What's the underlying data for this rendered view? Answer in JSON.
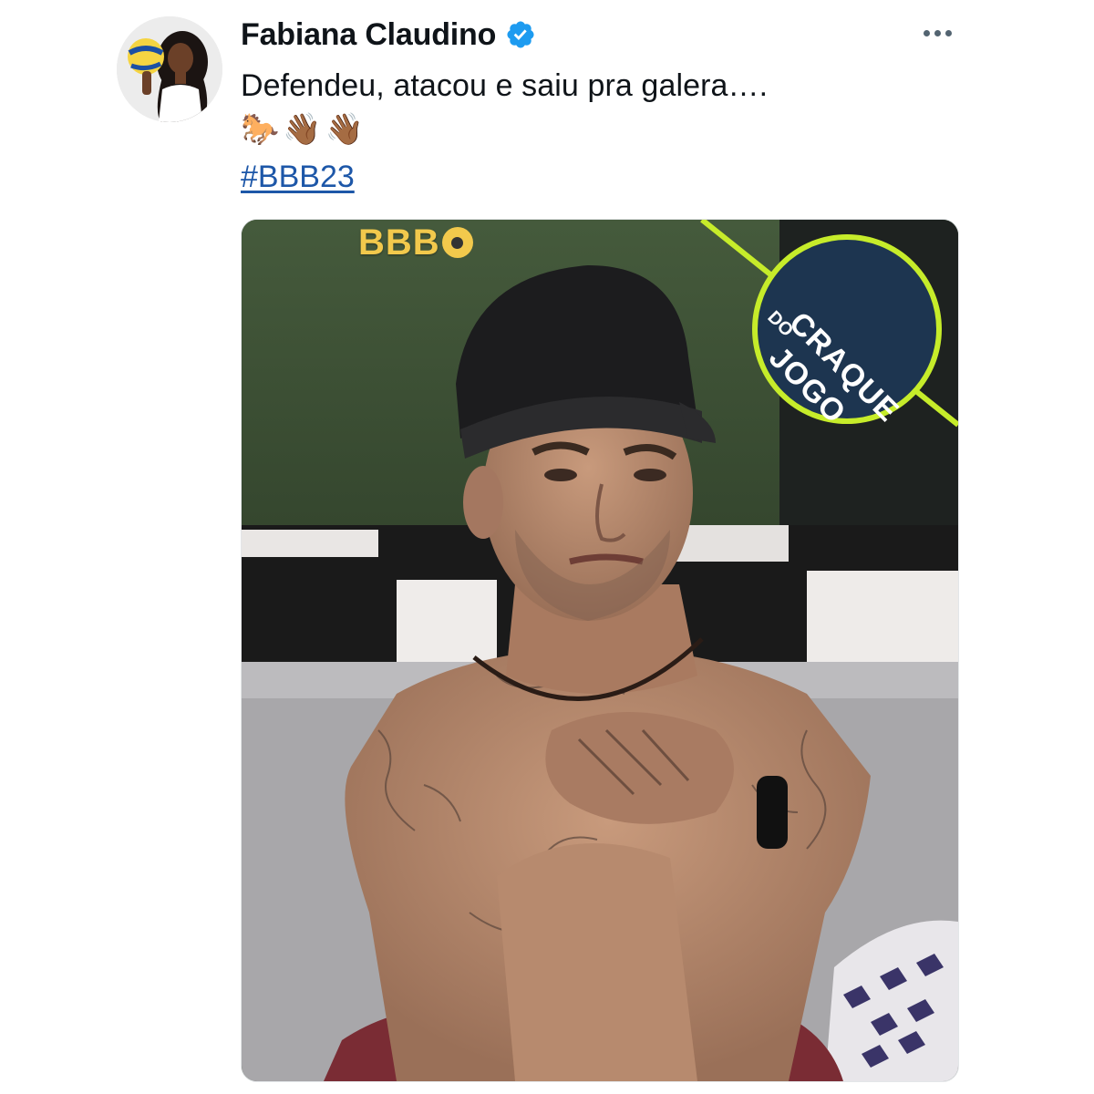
{
  "tweet": {
    "author": {
      "display_name": "Fabiana Claudino",
      "verified": true,
      "avatar_icon": "profile-photo"
    },
    "more_icon": "more-horizontal-icon",
    "text": "Defendeu, atacou e saiu pra galera….",
    "emojis": "🐎👋🏾👋🏾",
    "hashtag": "#BBB23"
  },
  "media": {
    "logo_text": "BBB",
    "badge_line1": "CRAQUE",
    "badge_line2": "DO",
    "badge_line3": "JOGO",
    "colors": {
      "badge_ring": "#c6ec2a",
      "badge_fill": "#1d3550",
      "logo": "#f2c94c",
      "background_green": "#3d4e35"
    }
  },
  "colors": {
    "hashtag": "#1d57a8",
    "verified": "#1d9bf0",
    "text": "#0f1419",
    "muted": "#536471"
  }
}
